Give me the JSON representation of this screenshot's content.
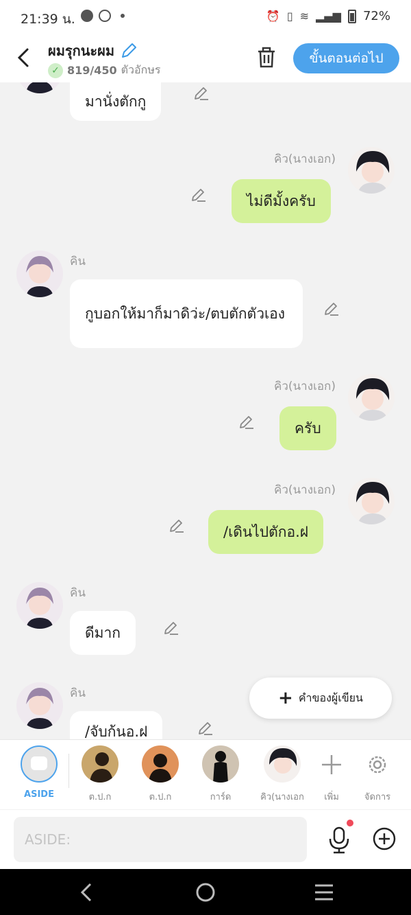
{
  "status": {
    "time": "21:39 น.",
    "battery": "72%"
  },
  "header": {
    "title": "ผมรุกนะผม",
    "char_count": "819/450",
    "char_unit": "ตัวอักษร",
    "next_label": "ขั้นตอนต่อไป"
  },
  "messages": [
    {
      "side": "left",
      "name": "",
      "text": "มานั่งตักกู"
    },
    {
      "side": "right",
      "name": "คิว(นางเอก)",
      "text": "ไม่ดีมั้งครับ"
    },
    {
      "side": "left",
      "name": "คิน",
      "text": "กูบอกให้มาก็มาดิว่ะ/ตบตักตัวเอง"
    },
    {
      "side": "right",
      "name": "คิว(นางเอก)",
      "text": "ครับ"
    },
    {
      "side": "right",
      "name": "คิว(นางเอก)",
      "text": "/เดินไปตักอ.ฝ"
    },
    {
      "side": "left",
      "name": "คิน",
      "text": "ดีมาก"
    },
    {
      "side": "left",
      "name": "คิน",
      "text": "/จับก้นอ.ฝ"
    }
  ],
  "fab": {
    "label": "คำของผู้เขียน"
  },
  "characters": [
    {
      "label": "ASIDE"
    },
    {
      "label": "ต.ป.ก"
    },
    {
      "label": "ต.ป.ก"
    },
    {
      "label": "การ์ด"
    },
    {
      "label": "คิว(นางเอก"
    },
    {
      "label": "เพิ่ม"
    },
    {
      "label": "จัดการ"
    }
  ],
  "input": {
    "placeholder": "ASIDE:"
  },
  "colors": {
    "accent": "#4da3ec",
    "green_bubble": "#d4f19a"
  }
}
